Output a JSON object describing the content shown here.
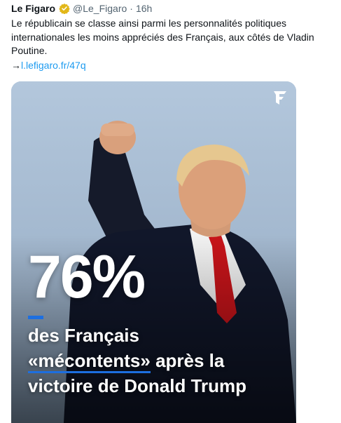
{
  "tweet": {
    "author_name": "Le Figaro",
    "handle": "@Le_Figaro",
    "separator": "·",
    "time": "16h",
    "text": "Le républicain se classe ainsi parmi les personnalités politiques\ninternationales les moins appréciés des Français, aux côtés de Vladin\nPoutine.",
    "link_arrow": "→",
    "link": "l.lefigaro.fr/47q"
  },
  "media": {
    "stat": "76%",
    "headline_1": "des Français",
    "headline_2_highlight": "«mécontents»",
    "headline_2_rest": " après la",
    "headline_3": "victoire de Donald Trump",
    "logo_icon": "le-figaro-f-logo",
    "accent": "#1d6fe0"
  },
  "colors": {
    "verified_badge": "#e2b719",
    "link": "#1d9bf0"
  }
}
